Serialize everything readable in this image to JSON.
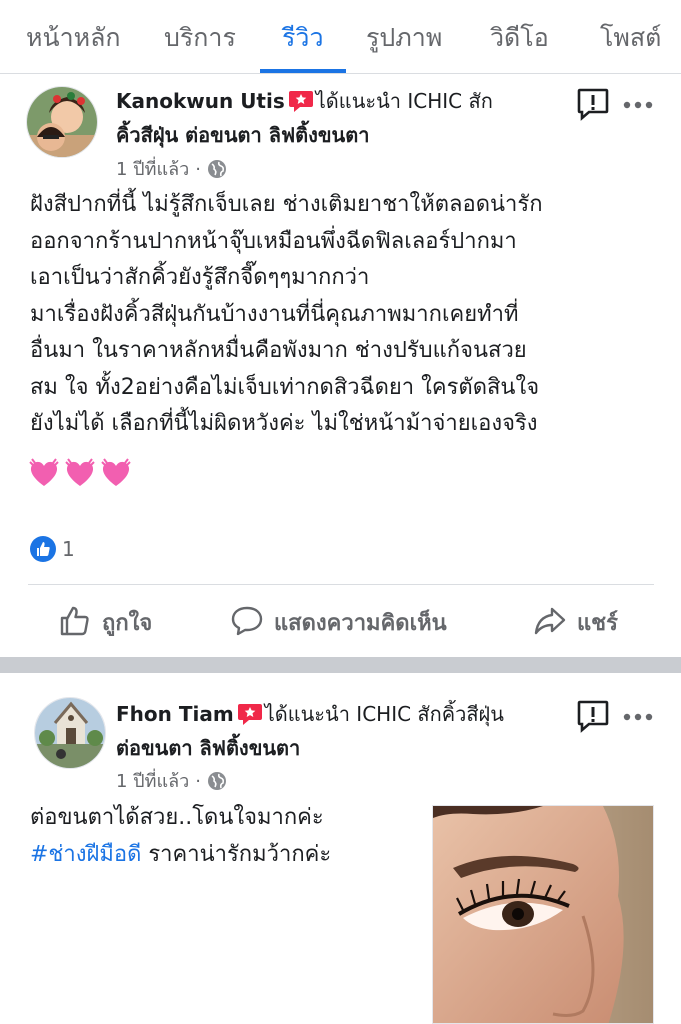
{
  "tabs": [
    "หน้าหลัก",
    "บริการ",
    "รีวิว",
    "รูปภาพ",
    "วิดีโอ",
    "โพสต์"
  ],
  "posts": [
    {
      "author": "Kanokwun Utis",
      "recommend_text": "ได้แนะนำ ICHIC สัก",
      "recommend_text_2": "คิ้วสีฝุ่น ต่อขนตา ลิฟติ้งขนตา",
      "time": "1 ปีที่แล้ว",
      "separator": "·",
      "body_lines": [
        "ฝังสีปากที่นี้ ไม่รู้สึกเจ็บเลย ช่างเติมยาชาให้ตลอดน่ารัก",
        "ออกจากร้านปากหน้าจุ๊บเหมือนพึ่งฉีดฟิลเลอร์ปากมา",
        "เอาเป็นว่าสักคิ้วยังรู้สึกจี๊ดๆๆมากกว่า",
        "มาเรื่องฝังคิ้วสีฝุ่นกันบ้างงานที่นี่คุณภาพมากเคยทำที่",
        "อื่นมา ในราคาหลักหมื่นคือพังมาก ช่างปรับแก้จนสวย",
        "สม ใจ ทั้ง2อย่างคือไม่เจ็บเท่ากดสิวฉีดยา ใครตัดสินใจ",
        "ยังไม่ได้ เลือกที่นี้ไม่ผิดหวังค่ะ ไม่ใช่หน้าม้าจ่ายเองจริง"
      ],
      "hearts": [
        "💓",
        "💓",
        "💓"
      ],
      "reaction_count": "1",
      "actions": {
        "like": "ถูกใจ",
        "comment": "แสดงความคิดเห็น",
        "share": "แชร์"
      }
    },
    {
      "author": "Fhon Tiam",
      "recommend_text": "ได้แนะนำ ICHIC สักคิ้วสีฝุ่น",
      "recommend_text_2": "ต่อขนตา ลิฟติ้งขนตา",
      "time": "1 ปีที่แล้ว",
      "separator": "·",
      "body_line_1": "ต่อขนตาได้สวย..โดนใจมากค่ะ",
      "hashtag": "#ช่างฝีมือดี",
      "body_line_2_rest": " ราคาน่ารักมว้ากค่ะ"
    }
  ],
  "colors": {
    "accent": "#1b74e4",
    "muted": "#65676b",
    "text": "#1c1e21",
    "recommend": "#f02849"
  },
  "icons": [
    "report-icon",
    "more-icon",
    "globe-icon",
    "recommend-icon",
    "like-icon",
    "comment-icon",
    "share-icon"
  ]
}
